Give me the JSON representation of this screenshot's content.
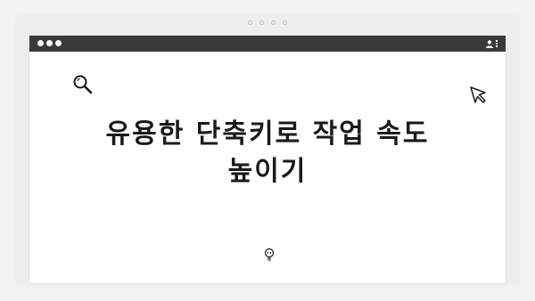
{
  "headline": {
    "line1": "유용한 단축키로 작업 속도",
    "line2": "높이기"
  },
  "icons": {
    "window_controls": "window-dots-icon",
    "account": "user-icon",
    "menu": "kebab-menu-icon",
    "search": "search-icon",
    "cursor": "cursor-arrow-icon",
    "idea": "lightbulb-icon"
  },
  "pager": {
    "count": 4
  },
  "colors": {
    "titlebar": "#3a3a3a",
    "text": "#1a1a1a",
    "background": "#f2f2f2"
  }
}
